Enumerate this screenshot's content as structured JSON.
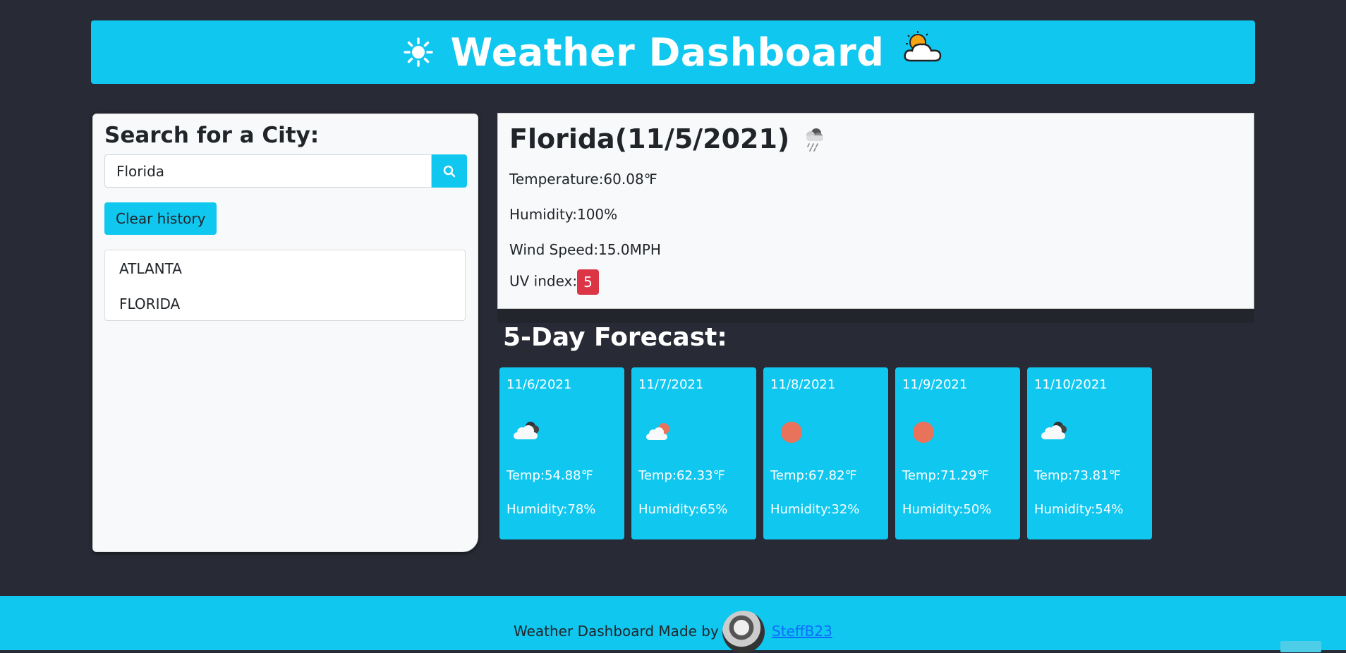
{
  "header": {
    "title": "Weather Dashboard",
    "sun_icon": "sun-icon",
    "cloud_icon": "sun-behind-cloud-icon",
    "color": "#10c7ef"
  },
  "sidebar": {
    "search_label": "Search for a City:",
    "search_value": "Florida",
    "search_icon": "search-icon",
    "clear_label": "Clear history",
    "history": [
      "ATLANTA",
      "FLORIDA"
    ]
  },
  "current": {
    "title": "Florida(11/5/2021)",
    "icon": "rain-cloud-icon",
    "temperature": "Temperature:60.08℉",
    "humidity": "Humidity:100%",
    "wind": "Wind Speed:15.0MPH",
    "uv_label": "UV index:",
    "uv_value": "5",
    "uv_color": "#dc3545"
  },
  "forecast": {
    "title": "5-Day Forecast:",
    "days": [
      {
        "date": "11/6/2021",
        "icon": "broken-clouds-icon",
        "temp": "Temp:54.88℉",
        "humidity": "Humidity:78%"
      },
      {
        "date": "11/7/2021",
        "icon": "few-clouds-icon",
        "temp": "Temp:62.33℉",
        "humidity": "Humidity:65%"
      },
      {
        "date": "11/8/2021",
        "icon": "clear-sky-icon",
        "temp": "Temp:67.82℉",
        "humidity": "Humidity:32%"
      },
      {
        "date": "11/9/2021",
        "icon": "clear-sky-icon",
        "temp": "Temp:71.29℉",
        "humidity": "Humidity:50%"
      },
      {
        "date": "11/10/2021",
        "icon": "broken-clouds-icon",
        "temp": "Temp:73.81℉",
        "humidity": "Humidity:54%"
      }
    ]
  },
  "footer": {
    "text": "Weather Dashboard Made by",
    "author": "SteffB23"
  }
}
